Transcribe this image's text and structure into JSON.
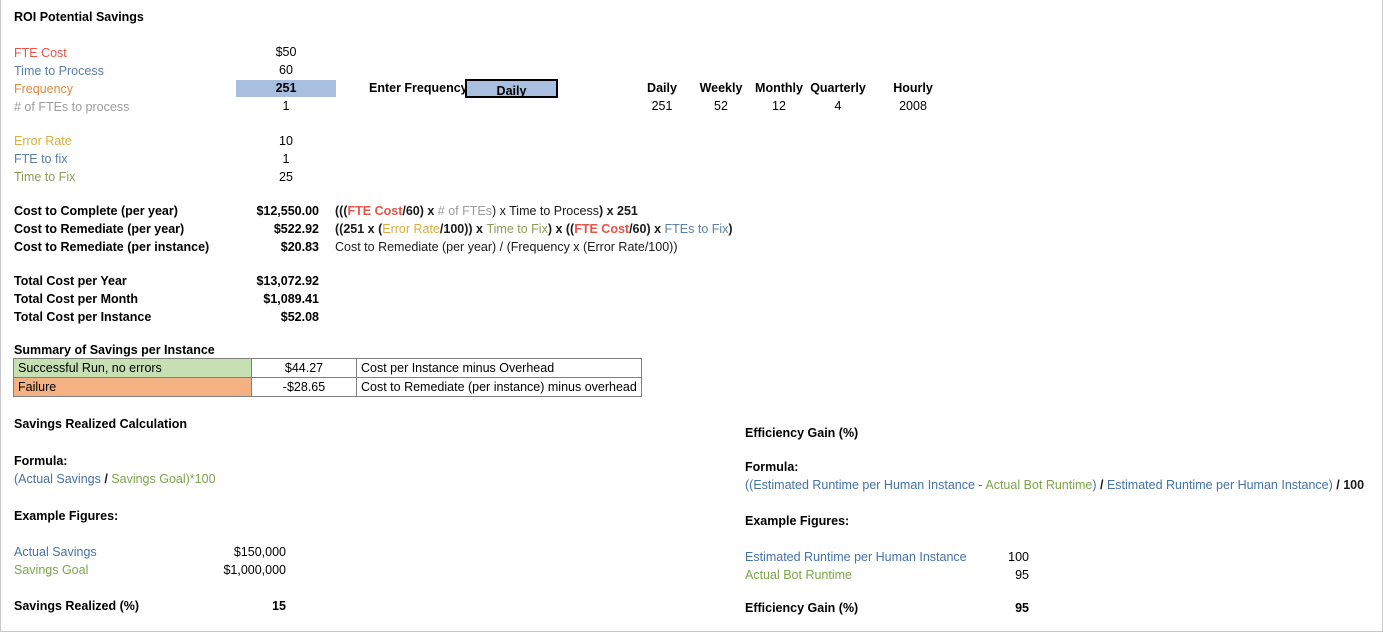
{
  "title": "ROI Potential Savings",
  "inputs": {
    "rows": [
      {
        "label": "FTE Cost",
        "value": "$50",
        "color": "c-red",
        "highlight": false
      },
      {
        "label": "Time to Process",
        "value": "60",
        "color": "c-blue",
        "highlight": false
      },
      {
        "label": "Frequency",
        "value": "251",
        "color": "c-orange",
        "highlight": true
      },
      {
        "label": "# of FTEs to process",
        "value": "1",
        "color": "c-gray",
        "highlight": false
      }
    ]
  },
  "error_inputs": {
    "rows": [
      {
        "label": "Error Rate",
        "value": "10",
        "color": "c-gold"
      },
      {
        "label": "FTE to fix",
        "value": "1",
        "color": "c-blue"
      },
      {
        "label": "Time to Fix",
        "value": "25",
        "color": "c-olive"
      }
    ]
  },
  "frequency_picker": {
    "label": "Enter Frequency:",
    "selected": "Daily"
  },
  "frequency_table": {
    "headers": [
      "Daily",
      "Weekly",
      "Monthly",
      "Quarterly",
      "Hourly"
    ],
    "values": [
      "251",
      "52",
      "12",
      "4",
      "2008"
    ]
  },
  "costs": {
    "rows": [
      {
        "label": "Cost to Complete (per year)",
        "value": "$12,550.00",
        "formula": [
          {
            "t": "(((",
            "c": "c-black",
            "b": true
          },
          {
            "t": "FTE Cost",
            "c": "c-red",
            "b": true
          },
          {
            "t": "/60) x ",
            "c": "c-black",
            "b": true
          },
          {
            "t": "# of FTEs",
            "c": "c-gray",
            "b": false
          },
          {
            "t": ") x ",
            "c": "c-black",
            "b": false
          },
          {
            "t": "Time to Process",
            "c": "c-black",
            "b": false
          },
          {
            "t": ") x 251",
            "c": "c-black",
            "b": true
          }
        ]
      },
      {
        "label": "Cost to Remediate (per year)",
        "value": "$522.92",
        "formula": [
          {
            "t": "((251 x (",
            "c": "c-black",
            "b": true
          },
          {
            "t": "Error Rate",
            "c": "c-gold",
            "b": false
          },
          {
            "t": "/100)) x ",
            "c": "c-black",
            "b": true
          },
          {
            "t": "Time to Fix",
            "c": "c-olive",
            "b": false
          },
          {
            "t": ") x ((",
            "c": "c-black",
            "b": true
          },
          {
            "t": "FTE Cost",
            "c": "c-red",
            "b": true
          },
          {
            "t": "/60) x ",
            "c": "c-black",
            "b": true
          },
          {
            "t": "FTEs to Fix",
            "c": "c-blue",
            "b": false
          },
          {
            "t": ")",
            "c": "c-black",
            "b": true
          }
        ]
      },
      {
        "label": "Cost to Remediate (per instance)",
        "value": "$20.83",
        "formula": [
          {
            "t": "Cost to Remediate (per year) / (Frequency x (Error Rate/100))",
            "c": "c-black",
            "b": false
          }
        ]
      }
    ]
  },
  "totals": {
    "rows": [
      {
        "label": "Total Cost per Year",
        "value": "$13,072.92"
      },
      {
        "label": "Total Cost per Month",
        "value": "$1,089.41"
      },
      {
        "label": "Total Cost per Instance",
        "value": "$52.08"
      }
    ]
  },
  "summary": {
    "heading": "Summary of Savings per Instance",
    "rows": [
      {
        "label": "Successful Run, no errors",
        "value": "$44.27",
        "note": "Cost per Instance minus Overhead"
      },
      {
        "label": "Failure",
        "value": "-$28.65",
        "note": "Cost to Remediate (per instance) minus overhead"
      }
    ]
  },
  "savings_section": {
    "heading": "Savings Realized Calculation",
    "formula_label": "Formula:",
    "formula": [
      {
        "t": "(Actual Savings",
        "c": "c-dkblue",
        "b": false
      },
      {
        "t": " / ",
        "c": "c-black",
        "b": true
      },
      {
        "t": "Savings Goal",
        "c": "c-green",
        "b": false
      },
      {
        "t": ")*100",
        "c": "c-green",
        "b": false
      }
    ],
    "examples_label": "Example Figures:",
    "examples": [
      {
        "label": "Actual Savings",
        "value": "$150,000",
        "color": "c-dkblue"
      },
      {
        "label": "Savings Goal",
        "value": "$1,000,000",
        "color": "c-green"
      }
    ],
    "result_label": "Savings Realized (%)",
    "result_value": "15"
  },
  "efficiency_section": {
    "heading": "Efficiency Gain (%)",
    "formula_label": "Formula:",
    "formula": [
      {
        "t": "((Estimated Runtime per Human Instance - ",
        "c": "c-dkblue",
        "b": false
      },
      {
        "t": "Actual Bot Runtime",
        "c": "c-green",
        "b": false
      },
      {
        "t": ")",
        "c": "c-dkblue",
        "b": false
      },
      {
        "t": " / ",
        "c": "c-black",
        "b": true
      },
      {
        "t": "Estimated Runtime per Human Instance)",
        "c": "c-dkblue",
        "b": false
      },
      {
        "t": " / ",
        "c": "c-black",
        "b": true
      },
      {
        "t": "100",
        "c": "c-black",
        "b": true
      }
    ],
    "examples_label": "Example Figures:",
    "examples": [
      {
        "label": "Estimated Runtime per Human Instance",
        "value": "100",
        "color": "c-dkblue"
      },
      {
        "label": "Actual Bot Runtime",
        "value": "95",
        "color": "c-green"
      }
    ],
    "result_label": "Efficiency Gain (%)",
    "result_value": "95"
  }
}
